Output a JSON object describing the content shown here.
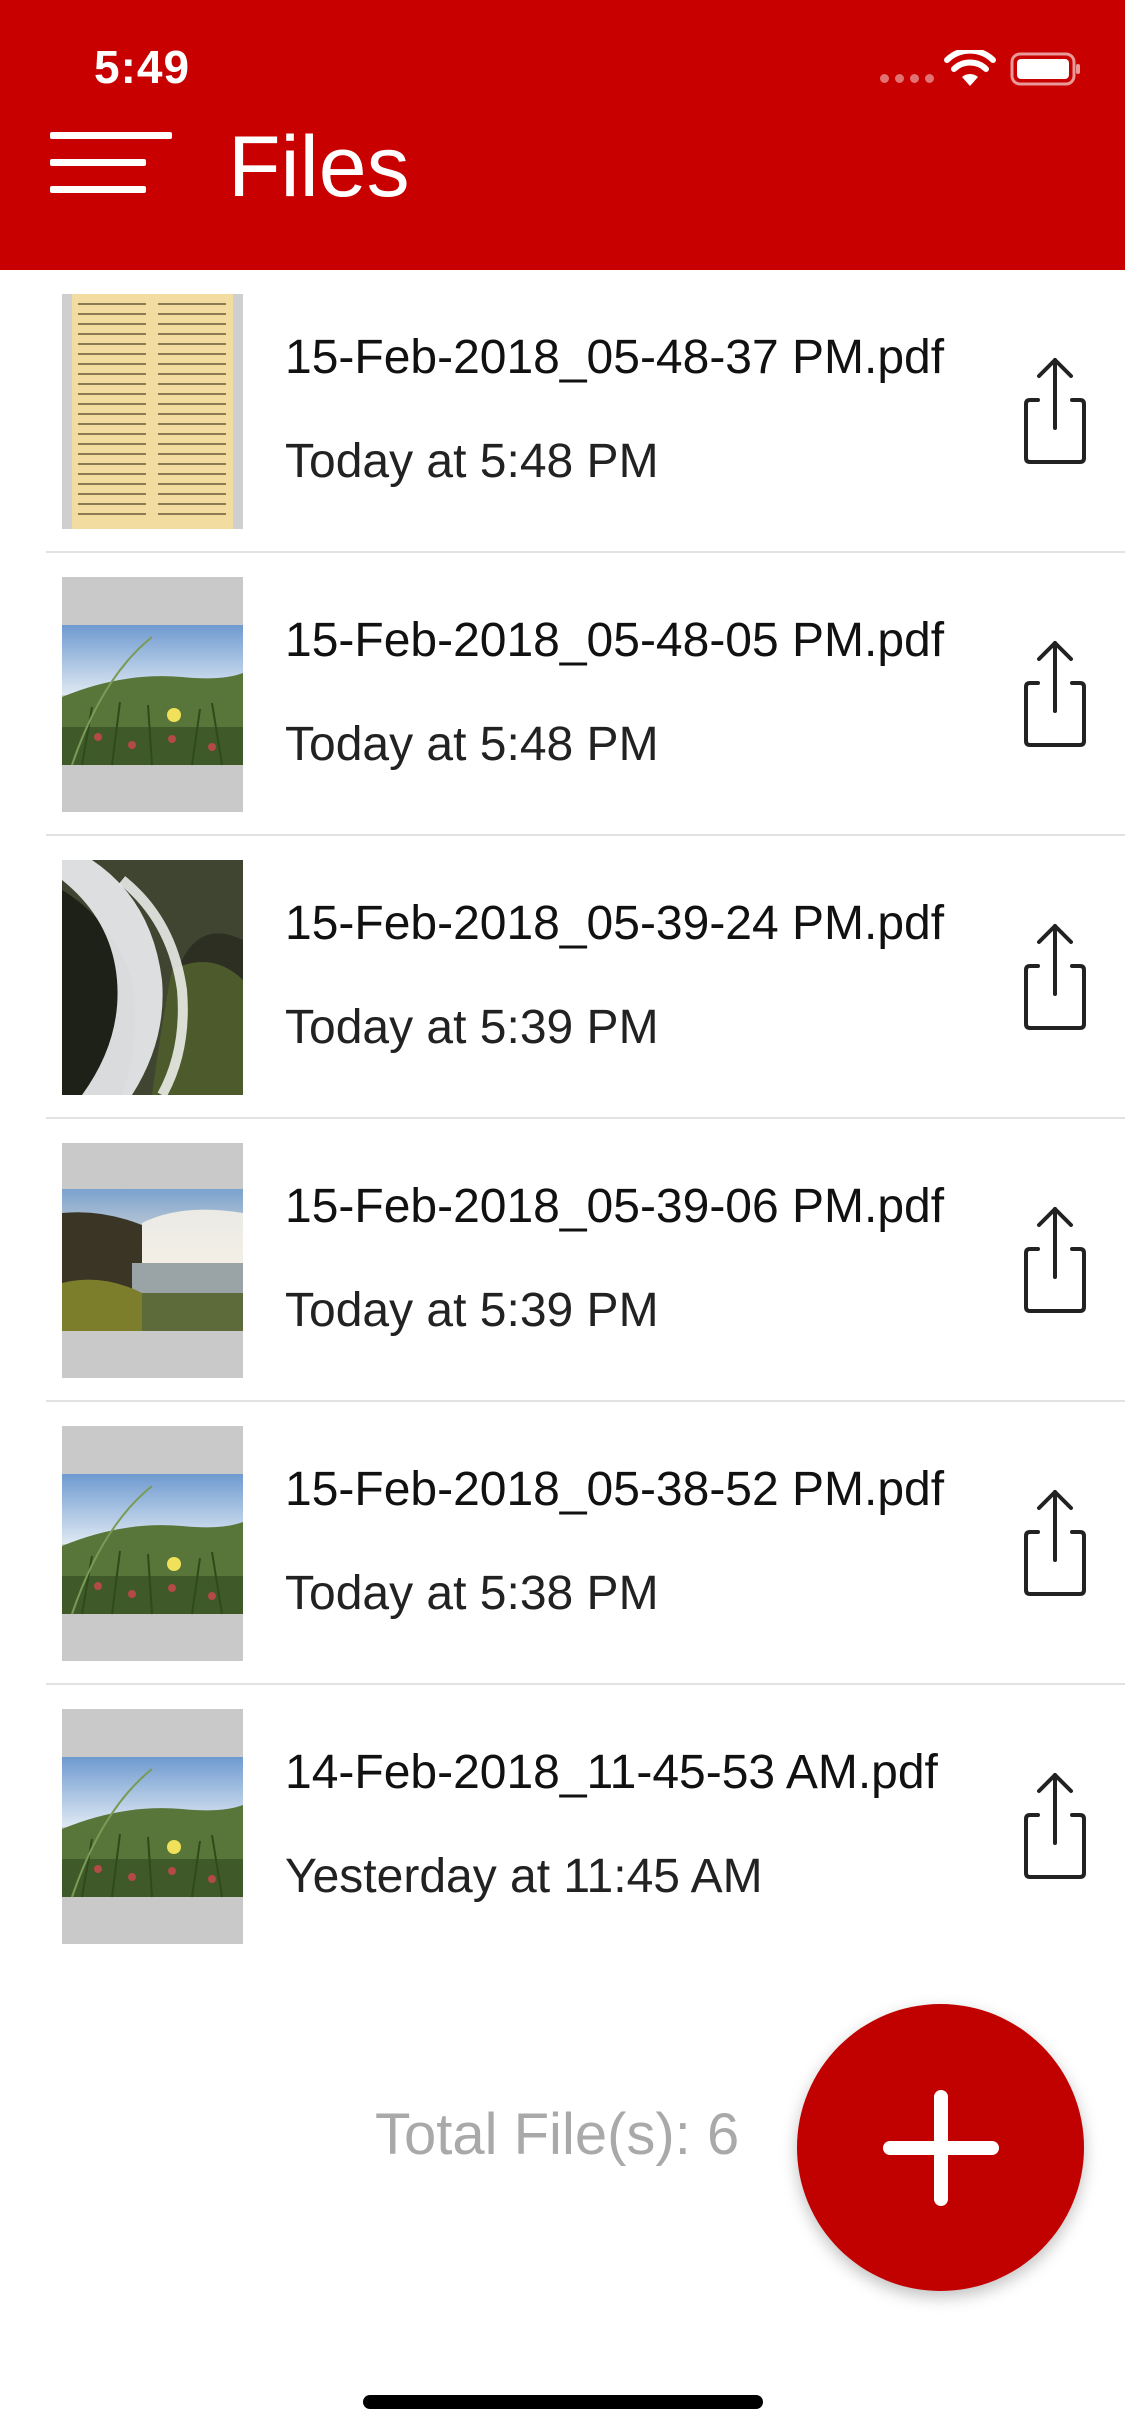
{
  "status_bar": {
    "time": "5:49"
  },
  "header": {
    "title": "Files",
    "menu_icon": "hamburger-menu-icon",
    "color": "#c80000"
  },
  "files": [
    {
      "name": "15-Feb-2018_05-48-37 PM.pdf",
      "date": "Today at 5:48 PM",
      "thumbnail": "newspaper-page"
    },
    {
      "name": "15-Feb-2018_05-48-05 PM.pdf",
      "date": "Today at 5:48 PM",
      "thumbnail": "flower-meadow"
    },
    {
      "name": "15-Feb-2018_05-39-24 PM.pdf",
      "date": "Today at 5:39 PM",
      "thumbnail": "waterfall-rocks"
    },
    {
      "name": "15-Feb-2018_05-39-06 PM.pdf",
      "date": "Today at 5:39 PM",
      "thumbnail": "waterfall-landscape"
    },
    {
      "name": "15-Feb-2018_05-38-52 PM.pdf",
      "date": "Today at 5:38 PM",
      "thumbnail": "flower-meadow"
    },
    {
      "name": "14-Feb-2018_11-45-53 AM.pdf",
      "date": "Yesterday at 11:45 AM",
      "thumbnail": "flower-meadow"
    }
  ],
  "footer": {
    "total_label": "Total File(s): 6",
    "fab_icon": "plus-icon",
    "fab_color": "#c10000"
  }
}
